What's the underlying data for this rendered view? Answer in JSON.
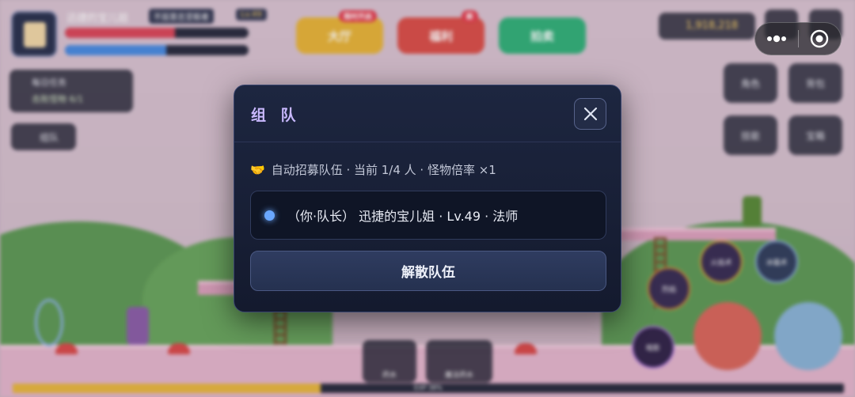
{
  "hud": {
    "player_name": "迅捷的宝儿姐",
    "player_tag": "不屈意志坚毅者",
    "player_level": "Lv.49",
    "hp_text": "",
    "mp_text": "",
    "daily_task_title": "每日任务",
    "daily_task_progress": "击败怪物 6/1",
    "chat_label": "组队",
    "buttons": [
      {
        "label": "大厅",
        "badge": "限时开启",
        "color": "#e7b43a"
      },
      {
        "label": "福利",
        "badge": "新",
        "color": "#d9504a"
      },
      {
        "label": "拍卖",
        "badge": "",
        "color": "#33b07a"
      }
    ],
    "coins": "1,918,218",
    "side_buttons": [
      "角色",
      "背包",
      "技能",
      "宝箱"
    ],
    "skills": [
      "火焰术",
      "冰霜术",
      "烈焰",
      "暗影"
    ],
    "bottom_items": [
      "药水",
      "魔法药水"
    ],
    "exp_text": "EXP 38%"
  },
  "capsule": {
    "more_icon": "more-dots-icon",
    "close_icon": "target-circle-icon"
  },
  "dialog": {
    "title": "组 队",
    "close_icon": "close-icon",
    "info_emoji": "🤝",
    "info_text": "自动招募队伍 · 当前 1/4 人 · 怪物倍率 ×1",
    "member": {
      "text": "（你·队长） 迅捷的宝儿姐 · Lv.49 · 法师",
      "dot_color": "#6aa7ff"
    },
    "disband_label": "解散队伍"
  }
}
